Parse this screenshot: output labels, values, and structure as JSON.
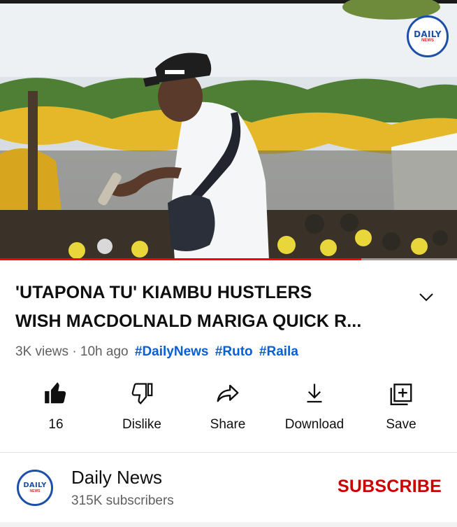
{
  "player": {
    "progress_percent": 79,
    "watermark": {
      "title": "DAILY",
      "subtitle": "NEWS"
    }
  },
  "video": {
    "title_line1": "'UTAPONA TU' KIAMBU HUSTLERS",
    "title_line2": "WISH MACDOLNALD MARIGA QUICK R...",
    "views": "3K views",
    "separator": "·",
    "age": "10h ago",
    "hashtags": [
      "#DailyNews",
      "#Ruto",
      "#Raila"
    ]
  },
  "actions": {
    "like": {
      "label": "16",
      "icon": "thumbs-up-icon"
    },
    "dislike": {
      "label": "Dislike",
      "icon": "thumbs-down-icon"
    },
    "share": {
      "label": "Share",
      "icon": "share-icon"
    },
    "download": {
      "label": "Download",
      "icon": "download-icon"
    },
    "save": {
      "label": "Save",
      "icon": "add-to-playlist-icon"
    }
  },
  "channel": {
    "name": "Daily News",
    "subscribers": "315K subscribers",
    "subscribe_label": "SUBSCRIBE",
    "avatar": {
      "title": "DAILY",
      "subtitle": "NEWS"
    }
  },
  "colors": {
    "progress": "#ff0000",
    "hashtag": "#065fd4",
    "subscribe": "#cc0000",
    "secondary_text": "#606060"
  }
}
